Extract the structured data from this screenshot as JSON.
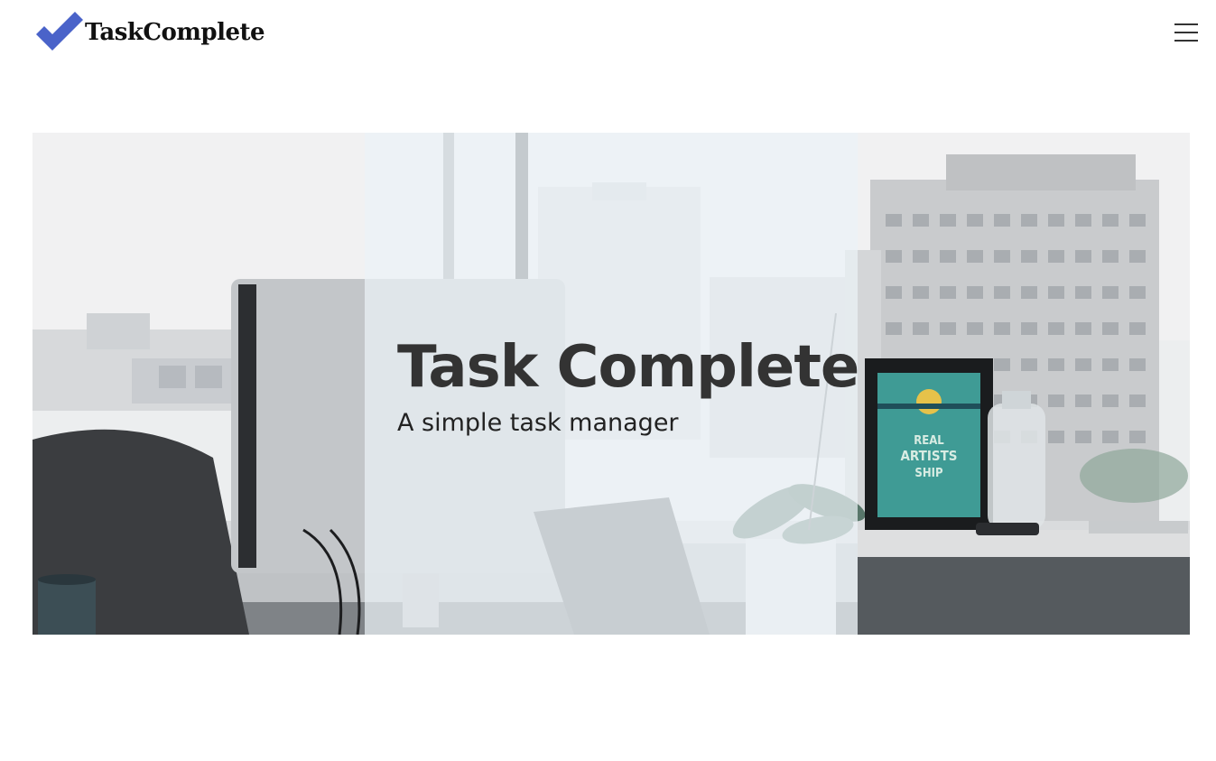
{
  "header": {
    "logo_text": "TaskComplete",
    "logo_icon": "checkmark-icon",
    "menu_icon": "hamburger-menu-icon"
  },
  "hero": {
    "title": "Task Complete",
    "subtitle": "A simple task manager",
    "poster_text": "REAL ARTISTS SHIP"
  },
  "colors": {
    "brand_accent": "#4a63c9",
    "text_dark": "#333333",
    "overlay": "#ecf2f7"
  }
}
